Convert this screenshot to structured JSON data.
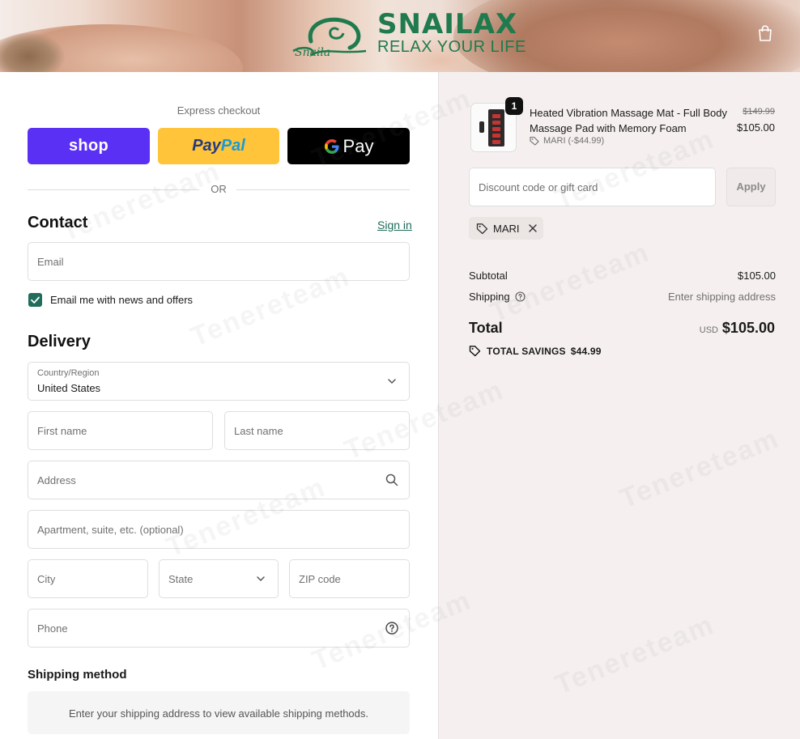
{
  "header": {
    "brand": "SNAILAX",
    "tagline": "RELAX YOUR LIFE",
    "cart_icon": "shopping-bag-icon"
  },
  "express": {
    "label": "Express checkout",
    "shop_label": "shop",
    "paypal_label_1": "Pay",
    "paypal_label_2": "Pal",
    "gpay_g": "G",
    "gpay_label": "Pay",
    "or_label": "OR"
  },
  "contact": {
    "title": "Contact",
    "signin_label": "Sign in",
    "email_placeholder": "Email",
    "news_label": "Email me with news and offers",
    "news_checked": true
  },
  "delivery": {
    "title": "Delivery",
    "country_label": "Country/Region",
    "country_value": "United States",
    "first_name_placeholder": "First name",
    "last_name_placeholder": "Last name",
    "address_placeholder": "Address",
    "apartment_placeholder": "Apartment, suite, etc. (optional)",
    "city_placeholder": "City",
    "state_placeholder": "State",
    "zip_placeholder": "ZIP code",
    "phone_placeholder": "Phone"
  },
  "shipping_method": {
    "title": "Shipping method",
    "message": "Enter your shipping address to view available shipping methods."
  },
  "summary": {
    "product": {
      "quantity": "1",
      "title": "Heated Vibration Massage Mat - Full Body Massage Pad with Memory Foam",
      "discount": "MARI (-$44.99)",
      "old_price": "$149.99",
      "price": "$105.00"
    },
    "discount_placeholder": "Discount code or gift card",
    "apply_label": "Apply",
    "applied_code": "MARI",
    "subtotal_label": "Subtotal",
    "subtotal_value": "$105.00",
    "shipping_label": "Shipping",
    "shipping_value": "Enter shipping address",
    "total_label": "Total",
    "currency": "USD",
    "total_value": "$105.00",
    "savings_label": "TOTAL SAVINGS",
    "savings_value": "$44.99"
  },
  "watermark": "Tenereteam",
  "colors": {
    "shop": "#5a31f4",
    "paypal": "#ffc439",
    "gpay": "#000000",
    "accent": "#1f6d5a",
    "brand_green": "#1f7a4d",
    "summary_bg": "#f5f0ef"
  }
}
